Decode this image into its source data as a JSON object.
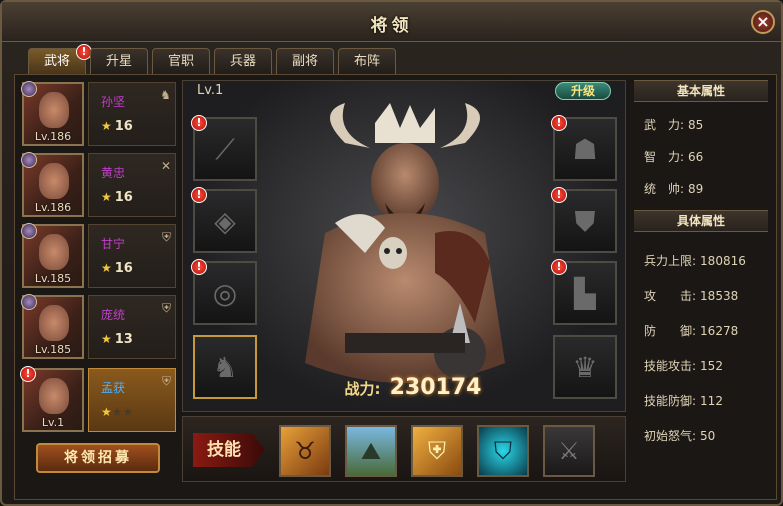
{
  "window": {
    "title": "将领",
    "close_label": "×"
  },
  "tabs": [
    {
      "label": "武将",
      "active": true,
      "alert": "!"
    },
    {
      "label": "升星"
    },
    {
      "label": "官职"
    },
    {
      "label": "兵器"
    },
    {
      "label": "副将"
    },
    {
      "label": "布阵"
    }
  ],
  "generals": [
    {
      "name": "孙坚",
      "level": "Lv.186",
      "stars": "16",
      "name_color": "#c040c8",
      "tag_icon": "horse-icon"
    },
    {
      "name": "黄忠",
      "level": "Lv.186",
      "stars": "16",
      "name_color": "#c040c8",
      "tag_icon": "crossed-weapons-icon"
    },
    {
      "name": "甘宁",
      "level": "Lv.185",
      "stars": "16",
      "name_color": "#c040c8",
      "tag_icon": "shield-icon"
    },
    {
      "name": "庞统",
      "level": "Lv.185",
      "stars": "13",
      "name_color": "#c040c8",
      "tag_icon": "shield-icon"
    },
    {
      "name": "孟获",
      "level": "Lv.1",
      "star_rating": 1,
      "star_max": 3,
      "name_color": "#4ab0ff",
      "tag_icon": "shield-icon",
      "alert": "!"
    }
  ],
  "recruit_label": "将领招募",
  "hero": {
    "level": "Lv.1",
    "upgrade_label": "升级",
    "power_label": "战力:",
    "power_value": "230174"
  },
  "equipment_left": [
    {
      "icon": "spear-icon",
      "alert": "!"
    },
    {
      "icon": "tablet-icon",
      "alert": "!"
    },
    {
      "icon": "ring-icon",
      "alert": "!"
    },
    {
      "icon": "horse-mount-icon"
    }
  ],
  "equipment_right": [
    {
      "icon": "helmet-icon",
      "alert": "!"
    },
    {
      "icon": "armor-icon",
      "alert": "!"
    },
    {
      "icon": "boots-icon",
      "alert": "!"
    },
    {
      "icon": "consort-icon"
    }
  ],
  "skills": {
    "label": "技能",
    "items": [
      {
        "icon": "beast-charge-icon",
        "color": "#c86a1a"
      },
      {
        "icon": "terrain-icon",
        "color": "#3a6a8a"
      },
      {
        "icon": "golden-shield-icon",
        "color": "#c8861a"
      },
      {
        "icon": "cyan-shield-icon",
        "color": "#1aa8b8"
      },
      {
        "icon": "locked-crossed-swords-icon",
        "color": "#3a3a3a"
      }
    ]
  },
  "stats": {
    "basic_title": "基本属性",
    "basic": [
      {
        "label": "武　力:",
        "value": "85"
      },
      {
        "label": "智　力:",
        "value": "66"
      },
      {
        "label": "统　帅:",
        "value": "89"
      }
    ],
    "detail_title": "具体属性",
    "detail": [
      {
        "label": "兵力上限:",
        "value": "180816"
      },
      {
        "label": "攻　　击:",
        "value": "18538"
      },
      {
        "label": "防　　御:",
        "value": "16278"
      },
      {
        "label": "技能攻击:",
        "value": "152"
      },
      {
        "label": "技能防御:",
        "value": "112"
      },
      {
        "label": "初始怒气:",
        "value": "50"
      }
    ]
  }
}
